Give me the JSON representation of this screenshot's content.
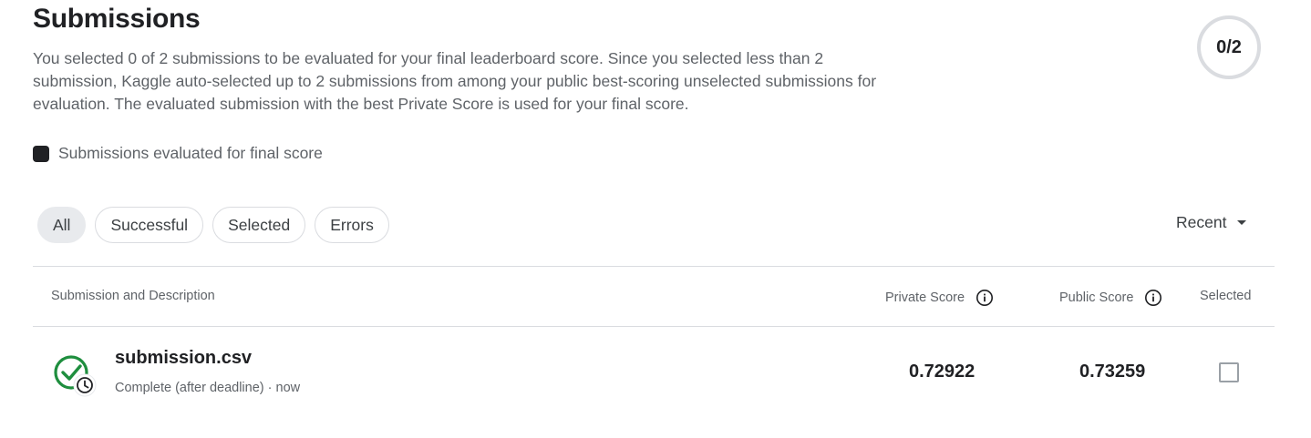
{
  "header": {
    "title": "Submissions",
    "description": "You selected 0 of 2 submissions to be evaluated for your final leaderboard score. Since you selected less than 2 submission, Kaggle auto-selected up to 2 submissions from among your public best-scoring unselected submissions for evaluation. The evaluated submission with the best Private Score is used for your final score.",
    "counter": "0/2"
  },
  "legend": {
    "label": "Submissions evaluated for final score"
  },
  "filters": [
    {
      "label": "All",
      "active": true
    },
    {
      "label": "Successful",
      "active": false
    },
    {
      "label": "Selected",
      "active": false
    },
    {
      "label": "Errors",
      "active": false
    }
  ],
  "sort": {
    "label": "Recent"
  },
  "table": {
    "columns": {
      "submission": "Submission and Description",
      "private": "Private Score",
      "public": "Public Score",
      "selected": "Selected"
    },
    "rows": [
      {
        "name": "submission.csv",
        "status": "Complete (after deadline) · now",
        "private_score": "0.72922",
        "public_score": "0.73259",
        "selected": false
      }
    ]
  },
  "colors": {
    "success_green": "#1e8e3e",
    "text_primary": "#202124",
    "text_secondary": "#5f6368"
  }
}
